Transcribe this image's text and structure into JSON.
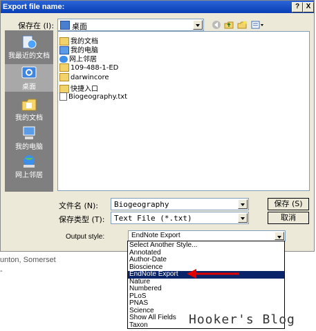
{
  "dialog": {
    "title": "Export file name:",
    "help_btn": "?",
    "close_btn": "X",
    "save_in_label": "保存在 (I):",
    "save_in_value": "桌面",
    "places": [
      {
        "label": "我最近的文档",
        "icon": "recent-documents-icon"
      },
      {
        "label": "桌面",
        "icon": "desktop-icon",
        "selected": true
      },
      {
        "label": "我的文档",
        "icon": "my-documents-icon"
      },
      {
        "label": "我的电脑",
        "icon": "my-computer-icon"
      },
      {
        "label": "网上邻居",
        "icon": "network-places-icon"
      }
    ],
    "files": [
      {
        "name": "我的文档",
        "icon": "my-documents-icon"
      },
      {
        "name": "我的电脑",
        "icon": "my-computer-icon"
      },
      {
        "name": "网上邻居",
        "icon": "network-places-icon"
      },
      {
        "name": "109-488-1-ED",
        "icon": "folder-icon"
      },
      {
        "name": "darwincore",
        "icon": "folder-icon"
      },
      {
        "name": "快捷入口",
        "icon": "folder-icon"
      },
      {
        "name": "Biogeography.txt",
        "icon": "text-file-icon"
      }
    ],
    "filename_label": "文件名 (N):",
    "filename_value": "Biogeography",
    "filetype_label": "保存类型 (T):",
    "filetype_value": "Text File (*.txt)",
    "save_button": "保存 (S)",
    "cancel_button": "取消",
    "output_style_label": "Output style:",
    "output_style_value": "EndNote Export"
  },
  "dropdown_options": [
    "Select Another Style...",
    "Annotated",
    "Author-Date",
    "Bioscience",
    "EndNote Export",
    "Nature",
    "Numbered",
    "PLoS",
    "PNAS",
    "Science",
    "Show All Fields",
    "Taxon"
  ],
  "selected_option_index": 4,
  "background_text": "unton, Somerset",
  "watermark": "Hooker's Blog",
  "colors": {
    "title_bar": "#0a3fb6",
    "selection": "#0a246a",
    "arrow": "#e00000"
  }
}
